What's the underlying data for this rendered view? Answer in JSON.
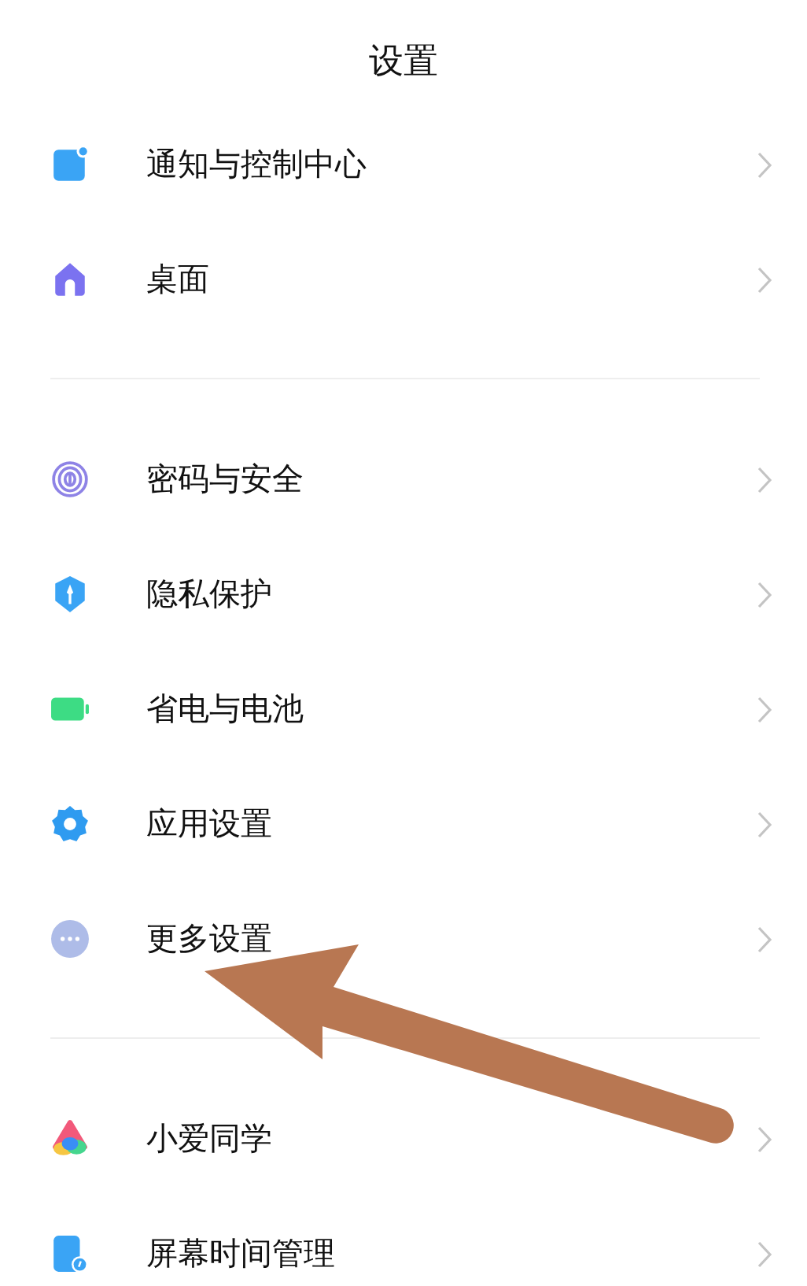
{
  "title": "设置",
  "groups": [
    {
      "items": [
        {
          "label": "通知与控制中心",
          "kind": "notification"
        },
        {
          "label": "桌面",
          "kind": "home"
        }
      ]
    },
    {
      "items": [
        {
          "label": "密码与安全",
          "kind": "fingerprint"
        },
        {
          "label": "隐私保护",
          "kind": "privacy"
        },
        {
          "label": "省电与电池",
          "kind": "battery"
        },
        {
          "label": "应用设置",
          "kind": "gear"
        },
        {
          "label": "更多设置",
          "kind": "more"
        }
      ]
    },
    {
      "items": [
        {
          "label": "小爱同学",
          "kind": "assistant"
        },
        {
          "label": "屏幕时间管理",
          "kind": "screentime"
        }
      ]
    }
  ]
}
